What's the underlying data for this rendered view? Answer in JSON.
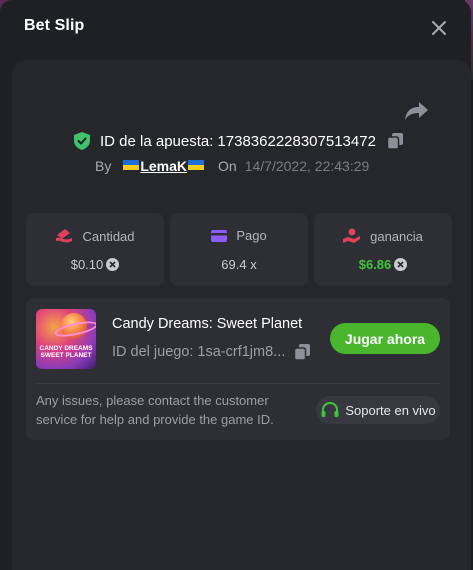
{
  "header": {
    "title": "Bet Slip"
  },
  "bet": {
    "id_label": "ID de la apuesta:",
    "id_value": "1738362228307513472",
    "by_label": "By",
    "username": "LemaK",
    "on_label": "On",
    "date": "14/7/2022, 22:43:29"
  },
  "stats": {
    "amount": {
      "label": "Cantidad",
      "value": "$0.10"
    },
    "payout": {
      "label": "Pago",
      "value": "69.4 x"
    },
    "profit": {
      "label": "ganancia",
      "value": "$6.86"
    }
  },
  "game": {
    "title": "Candy Dreams: Sweet Planet",
    "id_label": "ID del juego:",
    "id_value": "1sa-crf1jm8...",
    "play_label": "Jugar ahora",
    "thumb_line1": "CANDY DREAMS",
    "thumb_line2": "SWEET PLANET"
  },
  "support": {
    "help_text": "Any issues, please contact the customer service for help and provide the game ID.",
    "button_label": "Soporte en vivo"
  },
  "colors": {
    "accent_green": "#49b62e",
    "profit_green": "#41c43c",
    "amount_icon": "#e0405a",
    "payout_icon": "#8b5cf6",
    "profit_icon": "#e0405a",
    "shield_green": "#3fc26a"
  },
  "icons": {
    "close": "close-icon",
    "share": "share-icon",
    "verified": "shield-check-icon",
    "copy": "copy-icon",
    "amount": "cash-icon",
    "payout": "card-icon",
    "profit": "hand-coin-icon",
    "coin": "coin-icon",
    "support": "headset-icon"
  }
}
